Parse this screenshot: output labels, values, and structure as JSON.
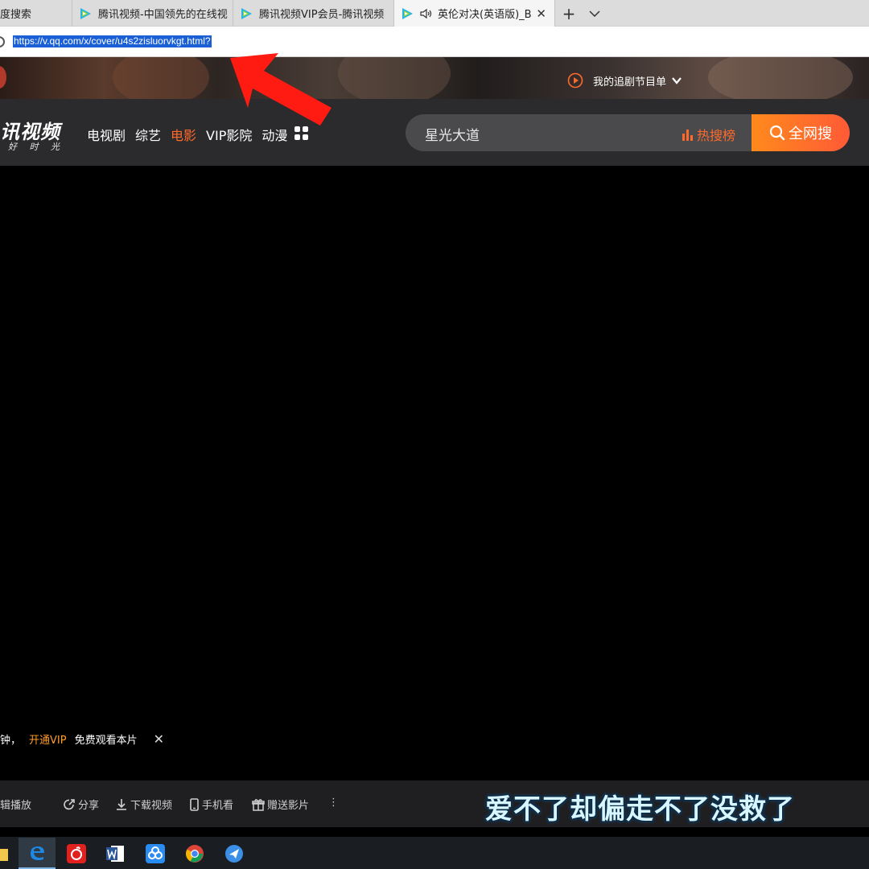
{
  "browser": {
    "tabs": [
      {
        "title": "度搜索"
      },
      {
        "title": "腾讯视频-中国领先的在线视"
      },
      {
        "title": "腾讯视频VIP会员-腾讯视频"
      },
      {
        "title": "英伦对决(英语版)_B"
      }
    ],
    "new_tab": "+",
    "tab_menu": "⌵",
    "url": "https://v.qq.com/x/cover/u4s2zisluorvkgt.html?"
  },
  "site": {
    "follow_label": "我的追剧节目单",
    "logo_main": "讯视频",
    "logo_sub": "好 时 光",
    "nav": [
      "电视剧",
      "综艺",
      "电影",
      "VIP影院",
      "动漫"
    ],
    "active_nav": "电影",
    "search_query": "星光大道",
    "hot_label": "热搜榜",
    "search_button": "全网搜"
  },
  "player": {
    "notice_prefix": "钟，",
    "notice_vip": "开通VIP",
    "notice_suffix": "免费观看本片",
    "subtitle": "爱不了却偏走不了没救了"
  },
  "toolbar": {
    "album_play": "专辑播放",
    "share": "分享",
    "download": "下载视频",
    "mobile": "手机看",
    "gift": "赠送影片",
    "more": "⋮"
  },
  "colors": {
    "accent": "#ff6a2b",
    "vip": "#ff9d2b",
    "annotation_arrow": "#ff1a12"
  }
}
